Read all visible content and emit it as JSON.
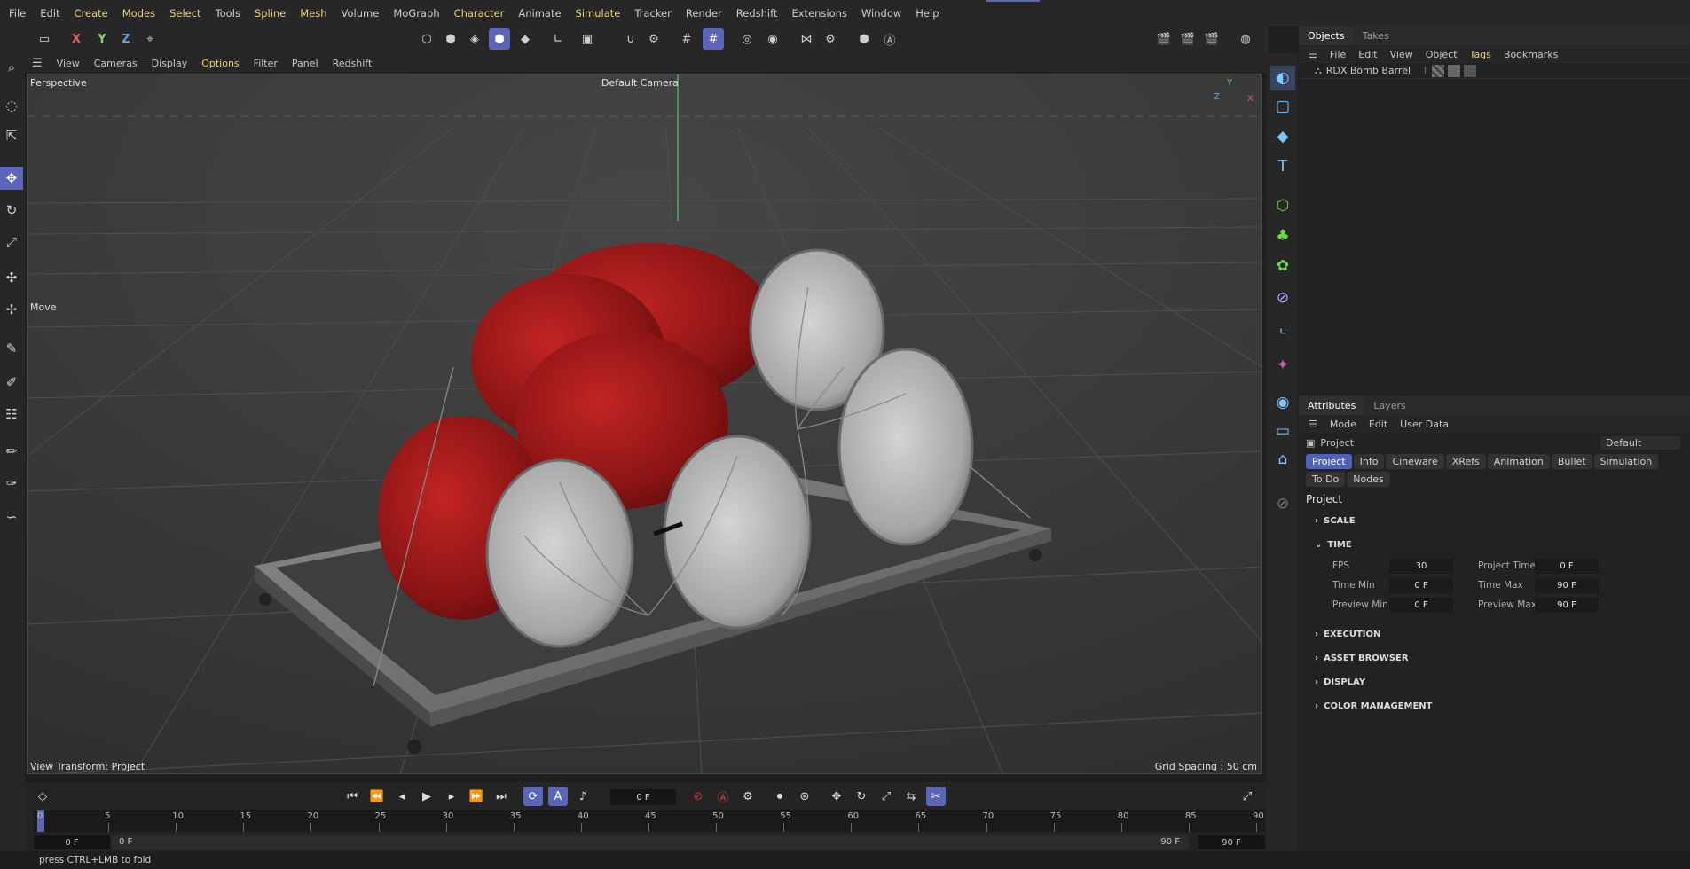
{
  "menu": [
    "File",
    "Edit",
    "Create",
    "Modes",
    "Select",
    "Tools",
    "Spline",
    "Mesh",
    "Volume",
    "MoGraph",
    "Character",
    "Animate",
    "Simulate",
    "Tracker",
    "Render",
    "Redshift",
    "Extensions",
    "Window",
    "Help"
  ],
  "toolbar": {
    "x": "X",
    "y": "Y",
    "z": "Z"
  },
  "viewport_menu": [
    "View",
    "Cameras",
    "Display",
    "Options",
    "Filter",
    "Panel",
    "Redshift"
  ],
  "viewport": {
    "name": "Perspective",
    "camera": "Default Camera",
    "tool": "Move",
    "view_transform": "View Transform: Project",
    "grid_spacing": "Grid Spacing : 50 cm",
    "axis_y": "Y",
    "axis_z": "Z",
    "axis_x": "X"
  },
  "objects_panel": {
    "tabs": [
      "Objects",
      "Takes"
    ],
    "menu": [
      "File",
      "Edit",
      "View",
      "Object",
      "Tags",
      "Bookmarks"
    ],
    "items": [
      {
        "name": "RDX Bomb Barrel"
      }
    ]
  },
  "attributes_panel": {
    "tabs": [
      "Attributes",
      "Layers"
    ],
    "menu": [
      "Mode",
      "Edit",
      "User Data"
    ],
    "context": "Project",
    "preset": "Default",
    "chips": [
      "Project",
      "Info",
      "Cineware",
      "XRefs",
      "Animation",
      "Bullet",
      "Simulation",
      "To Do",
      "Nodes"
    ],
    "section_title": "Project",
    "sections": {
      "scale": "SCALE",
      "time": "TIME",
      "execution": "EXECUTION",
      "asset_browser": "ASSET BROWSER",
      "display": "DISPLAY",
      "color_management": "COLOR MANAGEMENT"
    },
    "time": {
      "fps_label": "FPS",
      "fps": "30",
      "project_time_label": "Project Time",
      "project_time": "0 F",
      "time_min_label": "Time Min",
      "time_min": "0 F",
      "time_max_label": "Time Max",
      "time_max": "90 F",
      "preview_min_label": "Preview Min",
      "preview_min": "0 F",
      "preview_max_label": "Preview Max",
      "preview_max": "90 F"
    }
  },
  "timeline": {
    "current_frame": "0 F",
    "ticks": [
      "0",
      "5",
      "10",
      "15",
      "20",
      "25",
      "30",
      "35",
      "40",
      "45",
      "50",
      "55",
      "60",
      "65",
      "70",
      "75",
      "80",
      "85",
      "90"
    ],
    "range_start": "0 F",
    "range_min": "0 F",
    "range_max": "90 F",
    "range_end": "90 F"
  },
  "status": {
    "hint": "press CTRL+LMB to fold"
  },
  "colors": {
    "accent": "#5c66b8",
    "highlight_menu": "#e8d27a",
    "barrel_red": "#9a1a1a",
    "lid_gray": "#b8b8b8"
  }
}
